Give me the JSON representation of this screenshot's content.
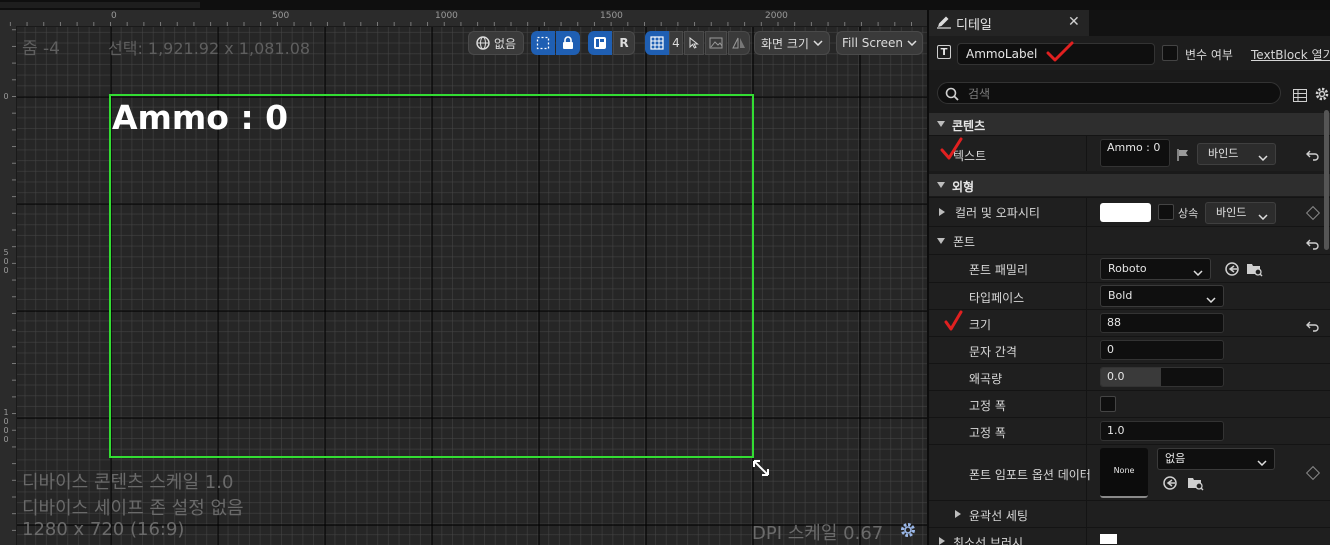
{
  "viewport": {
    "zoom_label": "줌 -4",
    "selection_info": "선택: 1,921.92 x 1,081.08",
    "ruler_top_labels": [
      "0",
      "500",
      "1000",
      "1500",
      "2000"
    ],
    "ruler_left_labels": [
      "0",
      "5\n0\n0",
      "1\n0\n0\n0"
    ],
    "toolbar": {
      "none_label": "없음",
      "r_label": "R",
      "grid_value": "4",
      "screen_size_label": "화면 크기",
      "fill_screen_label": "Fill Screen"
    },
    "canvas_text": "Ammo : 0",
    "canvas_border_color": "#33dd33",
    "info_lines": [
      "디바이스 콘텐츠 스케일 1.0",
      "디바이스 세이프 존 설정 없음",
      "1280 x 720 (16:9)"
    ],
    "dpi_label": "DPI 스케일 0.67"
  },
  "details": {
    "tab_label": "디테일",
    "widget_name": "AmmoLabel",
    "is_variable_label": "변수 여부",
    "widget_type_link": "TextBlock 열기",
    "search_placeholder": "검색",
    "categories": {
      "content": "콘텐츠",
      "appearance": "외형",
      "font": "폰트"
    },
    "rows": {
      "text_label": "텍스트",
      "text_value": "Ammo : 0",
      "bind_label": "바인드",
      "color_label": "컬러 및 오파시티",
      "inherit_label": "상속",
      "font_family_label": "폰트 패밀리",
      "font_family_value": "Roboto",
      "typeface_label": "타입페이스",
      "typeface_value": "Bold",
      "size_label": "크기",
      "size_value": "88",
      "letter_spacing_label": "문자 간격",
      "letter_spacing_value": "0",
      "skew_label": "왜곡량",
      "skew_value": "0.0",
      "fixed_width_label_1": "고정 폭",
      "fixed_width_label_2": "고정 폭",
      "fixed_width_value": "1.0",
      "font_import_label": "폰트 임포트 옵션 데이터",
      "font_import_thumb": "None",
      "font_import_value": "없음",
      "outline_label": "윤곽선 세팅",
      "min_size_label": "최소선 브러시"
    },
    "annotation_color": "#e02020"
  }
}
